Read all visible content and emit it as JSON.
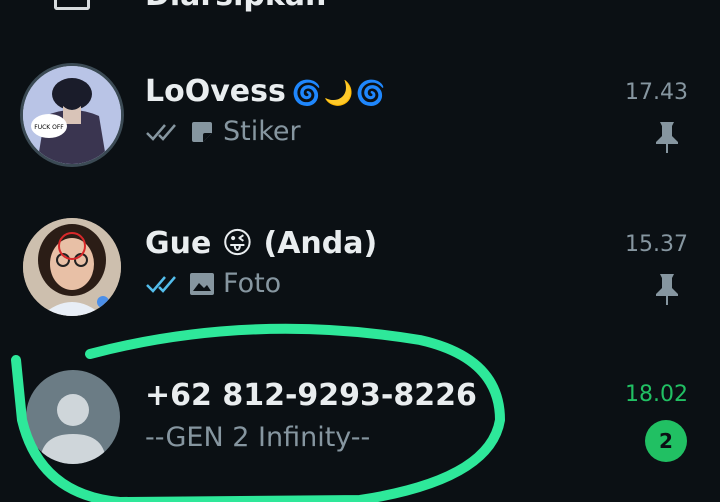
{
  "archived": {
    "label": "Diarsipkan"
  },
  "chats": [
    {
      "name": "LoOvess",
      "name_deco": "🌀🌙🌀",
      "preview_icon": "sticker-icon",
      "preview": "Stiker",
      "time": "17.43",
      "pinned": true,
      "avatar_text": "FUCK OFF"
    },
    {
      "name": "Gue 😜 (Anda)",
      "preview_icon": "photo-icon",
      "preview": "Foto",
      "time": "15.37",
      "pinned": true
    },
    {
      "name": "+62 812-9293-8226",
      "preview": "--GEN 2 Infinity--",
      "time": "18.02",
      "unread_count": "2"
    }
  ],
  "colors": {
    "background": "#0b1014",
    "accent_green": "#21c063",
    "read_tick_blue": "#53bdeb",
    "muted": "#8696a0",
    "annotation_green": "#2ee89a"
  }
}
